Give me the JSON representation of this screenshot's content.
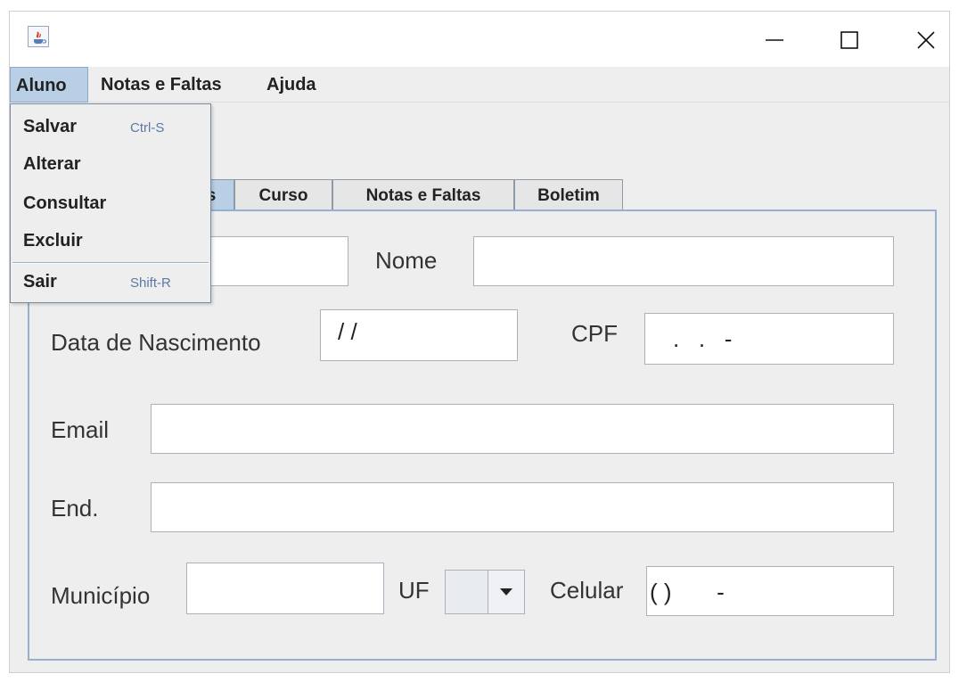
{
  "window": {
    "icon": "java-cup-icon",
    "controls": {
      "minimize": "minimize-icon",
      "maximize": "maximize-icon",
      "close": "close-icon"
    }
  },
  "menubar": {
    "items": [
      "Aluno",
      "Notas e Faltas",
      "Ajuda"
    ]
  },
  "menu_aluno": {
    "items": [
      {
        "label": "Salvar",
        "accelerator": "Ctrl-S"
      },
      {
        "label": "Alterar",
        "accelerator": ""
      },
      {
        "label": "Consultar",
        "accelerator": ""
      },
      {
        "label": "Excluir",
        "accelerator": ""
      },
      {
        "label": "Sair",
        "accelerator": "Shift-R"
      }
    ]
  },
  "tabs": [
    "s",
    "Curso",
    "Notas e Faltas",
    "Boletim"
  ],
  "form": {
    "nome_label": "Nome",
    "data_nascimento_label": "Data de Nascimento",
    "data_nascimento_mask": "/ /",
    "cpf_label": "CPF",
    "cpf_mask": ".   .   -",
    "email_label": "Email",
    "endereco_label": "End.",
    "municipio_label": "Município",
    "uf_label": "UF",
    "celular_label": "Celular",
    "celular_mask": "( )       -"
  },
  "colors": {
    "selection": "#b8cfe5",
    "panel_border": "#97afd0",
    "accelerator": "#5b79a8"
  }
}
